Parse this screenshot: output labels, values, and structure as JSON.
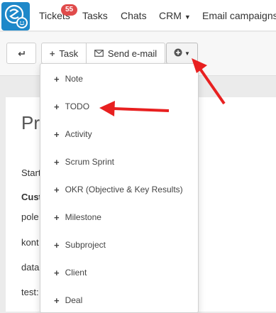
{
  "navbar": {
    "tickets_label": "Tickets",
    "tickets_badge": "55",
    "tasks_label": "Tasks",
    "chats_label": "Chats",
    "crm_label": "CRM",
    "email_label": "Email campaigns"
  },
  "toolbar": {
    "task_label": "Task",
    "send_email_label": "Send e-mail"
  },
  "page": {
    "title_partial": "Pro",
    "fields": [
      "Start",
      "Cust",
      "pole",
      "kont",
      "data",
      "test:"
    ]
  },
  "menu": {
    "items": [
      "Note",
      "TODO",
      "Activity",
      "Scrum Sprint",
      "OKR (Objective & Key Results)",
      "Milestone",
      "Subproject",
      "Client",
      "Deal"
    ]
  },
  "colors": {
    "brand": "#1e88c9",
    "badge": "#e04b4b",
    "annotation_arrow": "#e82020"
  },
  "icons": [
    "app-logo-icon",
    "chevron-down-icon",
    "back-icon",
    "plus-icon",
    "envelope-icon",
    "plus-circle-icon"
  ]
}
